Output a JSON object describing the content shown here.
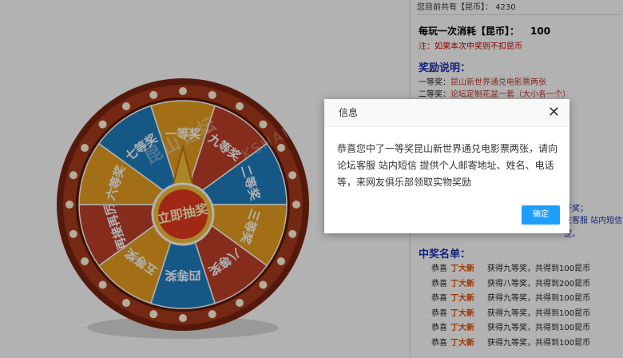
{
  "balance": {
    "label": "您目前共有【昆币】：",
    "value": "4230"
  },
  "cost": {
    "label": "每玩一次消耗【昆币】：",
    "value": "100"
  },
  "note": "注：如果本次中奖则不扣昆币",
  "rules": {
    "title": "奖励说明：",
    "items": [
      {
        "label": "一等奖：",
        "desc": "昆山新世界通兑电影票两张"
      },
      {
        "label": "二等奖：",
        "desc": "论坛定制花盆一套（大小各一个）"
      }
    ],
    "claim_lines": [
      "开奖；",
      "友客服 站内短信",
      "逻。"
    ]
  },
  "winners": {
    "title": "中奖名单：",
    "rows": [
      {
        "prefix": "恭喜",
        "name": "丁大新",
        "text": "获得九等奖，共得到100昆币"
      },
      {
        "prefix": "恭喜",
        "name": "丁大新",
        "text": "获得八等奖，共得到200昆币"
      },
      {
        "prefix": "恭喜",
        "name": "丁大新",
        "text": "获得九等奖，共得到100昆币"
      },
      {
        "prefix": "恭喜",
        "name": "丁大新",
        "text": "获得九等奖，共得到100昆币"
      },
      {
        "prefix": "恭喜",
        "name": "丁大新",
        "text": "获得九等奖，共得到100昆币"
      },
      {
        "prefix": "恭喜",
        "name": "丁大新",
        "text": "获得九等奖，共得到100昆币"
      }
    ]
  },
  "wheel": {
    "center_label": "立即抽奖",
    "segments": [
      {
        "label": "一等奖",
        "color": "#e8a020"
      },
      {
        "label": "九等奖",
        "color": "#c0402a"
      },
      {
        "label": "二等奖",
        "color": "#1f7ec0"
      },
      {
        "label": "三等奖",
        "color": "#e8a020"
      },
      {
        "label": "八等奖",
        "color": "#c0402a"
      },
      {
        "label": "四等奖",
        "color": "#1f7ec0"
      },
      {
        "label": "五等奖",
        "color": "#e8a020"
      },
      {
        "label": "再接再厉",
        "color": "#c0402a"
      },
      {
        "label": "六等奖",
        "color": "#e8a020"
      },
      {
        "label": "七等奖",
        "color": "#1f7ec0"
      }
    ]
  },
  "watermark": {
    "text": "昆山论坛",
    "sub": "KSHAN"
  },
  "dialog": {
    "title": "信息",
    "message": "恭喜您中了一等奖昆山新世界通兑电影票两张，请向 论坛客服 站内短信 提供个人邮寄地址、姓名、电话等，来网友俱乐部领取实物奖励",
    "ok_label": "确定"
  }
}
